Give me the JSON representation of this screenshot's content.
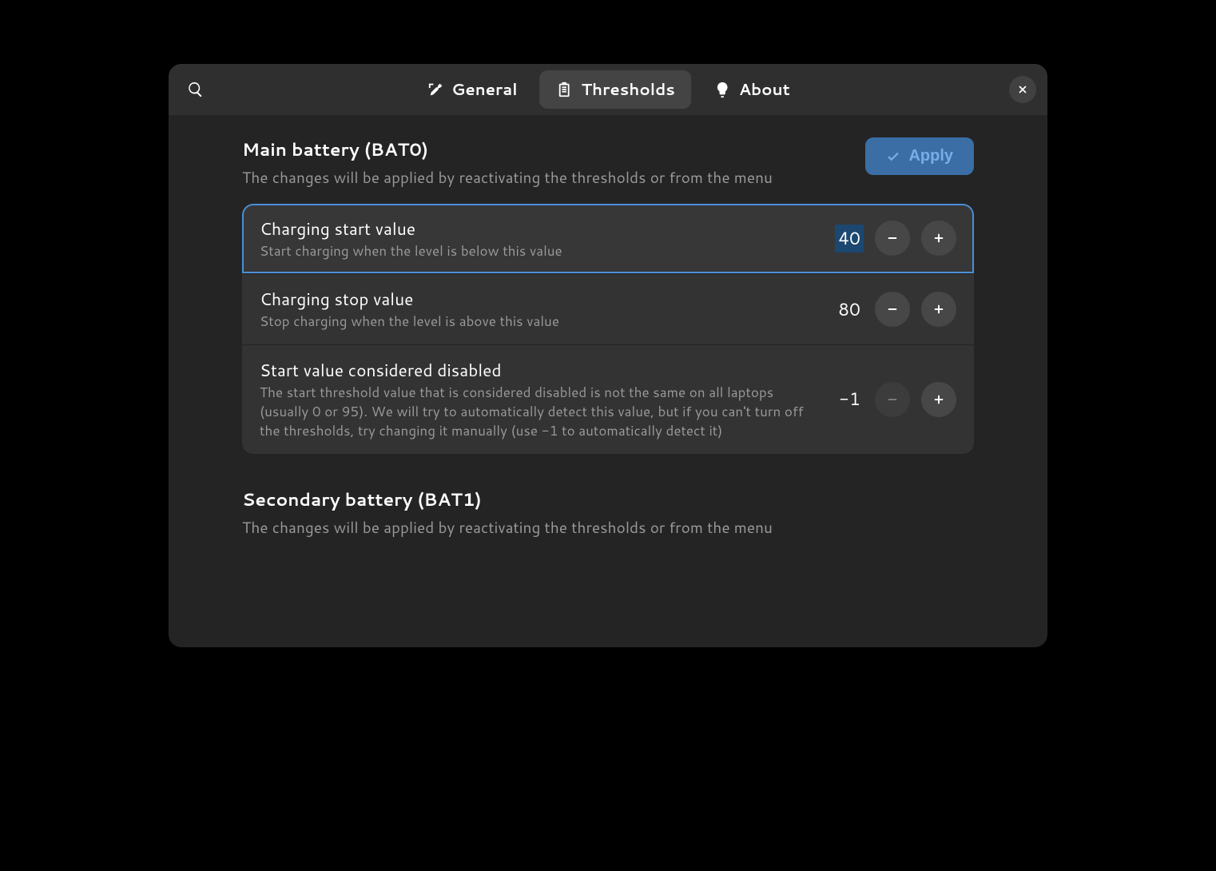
{
  "tabs": {
    "general": "General",
    "thresholds": "Thresholds",
    "about": "About"
  },
  "main": {
    "title": "Main battery (BAT0)",
    "subtitle": "The changes will be applied by reactivating the thresholds or from the menu",
    "apply": "Apply",
    "rows": {
      "start": {
        "title": "Charging start value",
        "sub": "Start charging when the level is below this value",
        "value": "40"
      },
      "stop": {
        "title": "Charging stop value",
        "sub": "Stop charging when the level is above this value",
        "value": "80"
      },
      "disabled": {
        "title": "Start value considered disabled",
        "sub": "The start threshold value that is considered disabled is not the same on all laptops (usually 0 or 95). We will try to automatically detect this value, but if you can't turn off the thresholds, try changing it manually (use -1 to automatically detect it)",
        "value": "-1"
      }
    }
  },
  "secondary": {
    "title": "Secondary battery (BAT1)",
    "subtitle": "The changes will be applied by reactivating the thresholds or from the menu"
  }
}
